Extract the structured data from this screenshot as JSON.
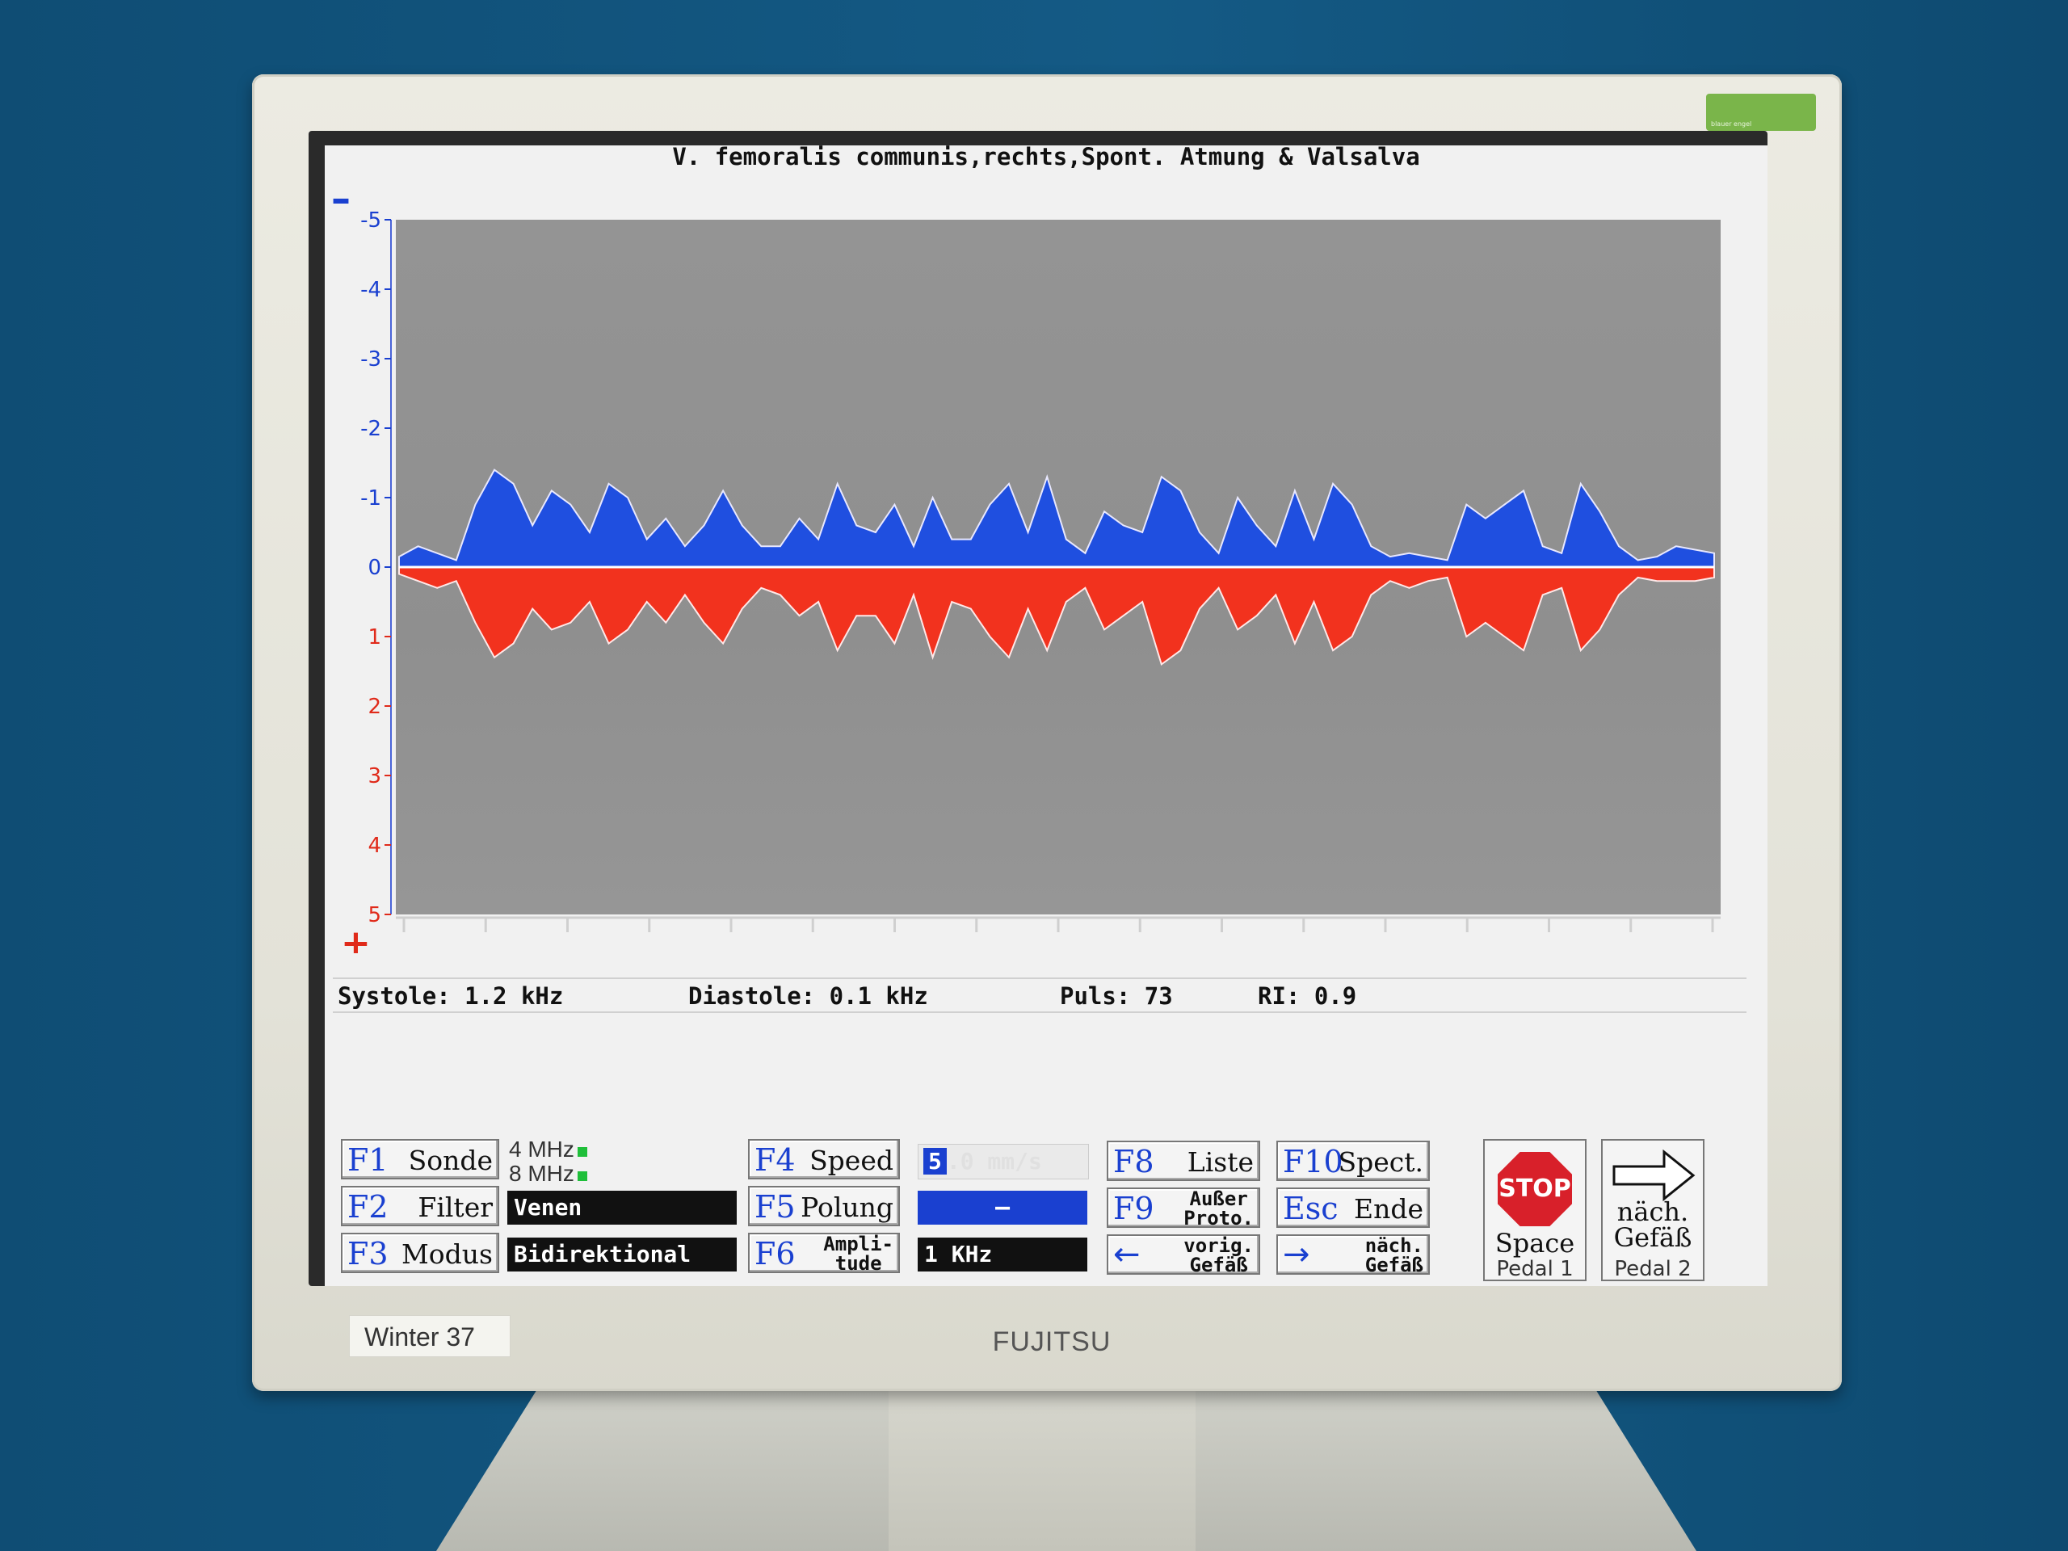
{
  "title": "V. femoralis communis,rechts,Spont. Atmung & Valsalva",
  "stats": {
    "systole": "Systole: 1.2 kHz",
    "diastole": "Diastole: 0.1 kHz",
    "puls": "Puls: 73",
    "ri": "RI: 0.9"
  },
  "keys": {
    "f1": {
      "key": "F1",
      "label": "Sonde"
    },
    "f2": {
      "key": "F2",
      "label": "Filter"
    },
    "f3": {
      "key": "F3",
      "label": "Modus"
    },
    "f4": {
      "key": "F4",
      "label": "Speed"
    },
    "f5": {
      "key": "F5",
      "label": "Polung"
    },
    "f6": {
      "key": "F6",
      "label_line1": "Ampli-",
      "label_line2": "tude"
    },
    "f8": {
      "key": "F8",
      "label": "Liste"
    },
    "f9": {
      "key": "F9",
      "label_line1": "Außer",
      "label_line2": "Proto."
    },
    "f10": {
      "key": "F10",
      "label": "Spect."
    },
    "esc": {
      "key": "Esc",
      "label": "Ende"
    },
    "prev": {
      "arrow": "←",
      "label_line1": "vorig.",
      "label_line2": "Gefäß"
    },
    "next": {
      "arrow": "→",
      "label_line1": "näch.",
      "label_line2": "Gefäß"
    }
  },
  "probe": {
    "mhz4": "4 MHz",
    "mhz8": "8 MHz"
  },
  "values": {
    "filter": "Venen",
    "modus": "Bidirektional",
    "speed_digit": "5",
    "speed_rest": ".0 mm/s",
    "polung": "–",
    "amplitude": "1 KHz"
  },
  "stop": {
    "sign": "STOP",
    "label": "Space",
    "pedal": "Pedal 1"
  },
  "next_vessel": {
    "label_line1": "näch.",
    "label_line2": "Gefäß",
    "pedal": "Pedal 2"
  },
  "monitor": {
    "label": "Winter 37",
    "brand": "FUJITSU"
  },
  "colors": {
    "upper": "#1f4fe0",
    "lower": "#f2321e",
    "plot_bg": "#929292",
    "key_blue": "#1a40d0"
  },
  "chart_data": {
    "type": "area",
    "yaxis_ticks": [
      "-5",
      "-4",
      "-3",
      "-2",
      "-1",
      "0",
      "1",
      "2",
      "3",
      "4",
      "5"
    ],
    "ylim": [
      -5,
      5
    ],
    "axis_marks": {
      "minus": "–",
      "plus": "+"
    },
    "series": [
      {
        "values": [
          0.15,
          0.3,
          0.2,
          0.1,
          0.9,
          1.4,
          1.2,
          0.6,
          1.1,
          0.9,
          0.5,
          1.2,
          1.0,
          0.4,
          0.7,
          0.3,
          0.6,
          1.1,
          0.6,
          0.3,
          0.3,
          0.7,
          0.4,
          1.2,
          0.6,
          0.5,
          0.9,
          0.3,
          1.0,
          0.4,
          0.4,
          0.9,
          1.2,
          0.5,
          1.3,
          0.4,
          0.2,
          0.8,
          0.6,
          0.5,
          1.3,
          1.1,
          0.5,
          0.2,
          1.0,
          0.6,
          0.3,
          1.1,
          0.4,
          1.2,
          0.9,
          0.3,
          0.15,
          0.2,
          0.15,
          0.1,
          0.9,
          0.7,
          0.9,
          1.1,
          0.3,
          0.2,
          1.2,
          0.8,
          0.3,
          0.1,
          0.15,
          0.3,
          0.25,
          0.2
        ]
      },
      {
        "values": [
          0.1,
          0.2,
          0.3,
          0.2,
          0.8,
          1.3,
          1.1,
          0.6,
          0.9,
          0.8,
          0.5,
          1.1,
          0.9,
          0.5,
          0.8,
          0.4,
          0.8,
          1.1,
          0.6,
          0.3,
          0.4,
          0.7,
          0.5,
          1.2,
          0.7,
          0.7,
          1.1,
          0.4,
          1.3,
          0.5,
          0.6,
          1.0,
          1.3,
          0.6,
          1.2,
          0.5,
          0.3,
          0.9,
          0.7,
          0.5,
          1.4,
          1.2,
          0.6,
          0.3,
          0.9,
          0.7,
          0.4,
          1.1,
          0.5,
          1.2,
          1.0,
          0.4,
          0.2,
          0.3,
          0.2,
          0.15,
          1.0,
          0.8,
          1.0,
          1.2,
          0.4,
          0.3,
          1.2,
          0.9,
          0.4,
          0.15,
          0.2,
          0.2,
          0.2,
          0.15
        ]
      }
    ]
  }
}
